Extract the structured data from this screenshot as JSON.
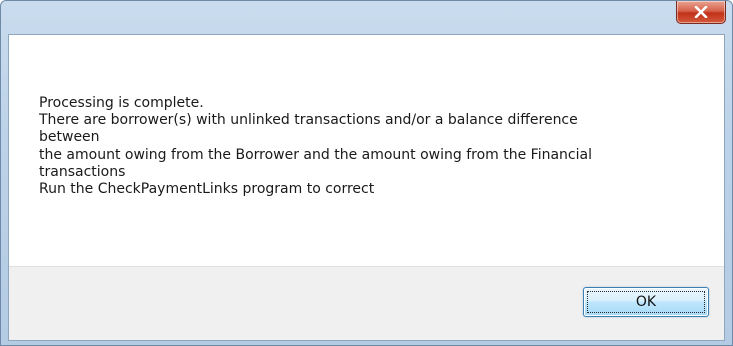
{
  "dialog": {
    "title": "",
    "close_icon": "close-icon",
    "message_lines": [
      "Processing is complete.",
      "There are borrower(s) with unlinked transactions and/or a balance difference",
      "between",
      "the amount owing from the Borrower and the amount owing from the Financial",
      "transactions",
      "Run the CheckPaymentLinks program to correct"
    ],
    "ok_label": "OK"
  },
  "colors": {
    "titlebar": "#bcd2e8",
    "close_button": "#c1311a",
    "footer": "#f0f0f0",
    "ok_border": "#3c7fb1"
  }
}
